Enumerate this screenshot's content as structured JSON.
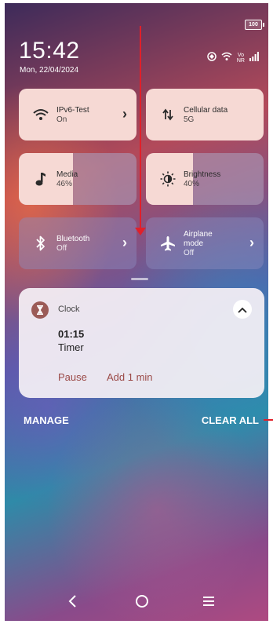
{
  "status_bar": {
    "battery": "100",
    "time": "15:42",
    "date": "Mon, 22/04/2024",
    "icons": [
      "nfc-icon",
      "wifi-icon",
      "volte-icon",
      "signal-icon"
    ],
    "volte_text_top": "Vo",
    "volte_text_bottom": "NR"
  },
  "tiles": {
    "wifi": {
      "title": "IPv6-Test",
      "subtitle": "On",
      "state": "on"
    },
    "cellular": {
      "title": "Cellular data",
      "subtitle": "5G",
      "state": "on"
    },
    "media": {
      "title": "Media",
      "value": "46%",
      "level_percent": 46
    },
    "brightness": {
      "title": "Brightness",
      "value": "40%",
      "level_percent": 40
    },
    "bluetooth": {
      "title": "Bluetooth",
      "subtitle": "Off",
      "state": "off"
    },
    "airplane": {
      "title_line1": "Airplane",
      "title_line2": "mode",
      "subtitle": "Off",
      "state": "off"
    }
  },
  "notification": {
    "app": "Clock",
    "time": "01:15",
    "label": "Timer",
    "actions": {
      "pause": "Pause",
      "add": "Add 1 min"
    }
  },
  "footer": {
    "manage": "MANAGE",
    "clear_all": "CLEAR ALL"
  },
  "colors": {
    "accent": "#9b4a47",
    "tile_on": "#f6d9d4",
    "annotation": "#e0202a"
  }
}
